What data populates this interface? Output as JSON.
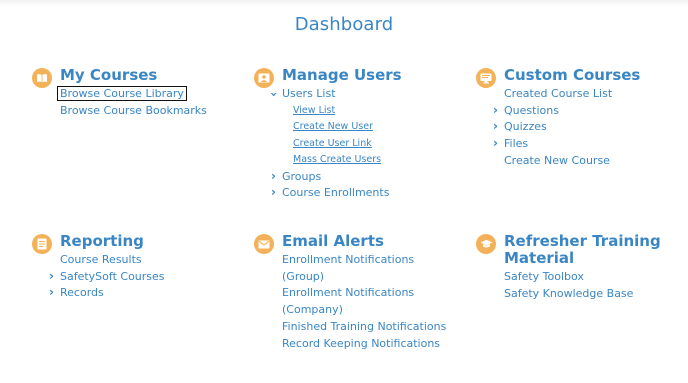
{
  "page": {
    "title": "Dashboard"
  },
  "sections": {
    "my_courses": {
      "title": "My Courses",
      "icon": "book-icon",
      "links": [
        "Browse Course Library",
        "Browse Course Bookmarks"
      ]
    },
    "manage_users": {
      "title": "Manage Users",
      "icon": "user-card-icon",
      "links": [
        "Users List",
        "View List",
        "Create New User",
        "Create User Link",
        "Mass Create Users",
        "Groups",
        "Course Enrollments"
      ]
    },
    "custom_courses": {
      "title": "Custom Courses",
      "icon": "monitor-icon",
      "links": [
        "Created Course List",
        "Questions",
        "Quizzes",
        "Files",
        "Create New Course"
      ]
    },
    "reporting": {
      "title": "Reporting",
      "icon": "document-icon",
      "links": [
        "Course Results",
        "SafetySoft Courses",
        "Records"
      ]
    },
    "email_alerts": {
      "title": "Email Alerts",
      "icon": "envelope-icon",
      "links": [
        "Enrollment Notifications",
        "(Group)",
        "Enrollment Notifications",
        "(Company)",
        "Finished Training Notifications",
        "Record Keeping Notifications"
      ]
    },
    "refresher": {
      "title": "Refresher Training Material",
      "icon": "graduation-cap-icon",
      "links": [
        "Safety Toolbox",
        "Safety Knowledge Base"
      ]
    }
  },
  "colors": {
    "accent": "#3a86c4",
    "icon_bg": "#f3b25a"
  }
}
